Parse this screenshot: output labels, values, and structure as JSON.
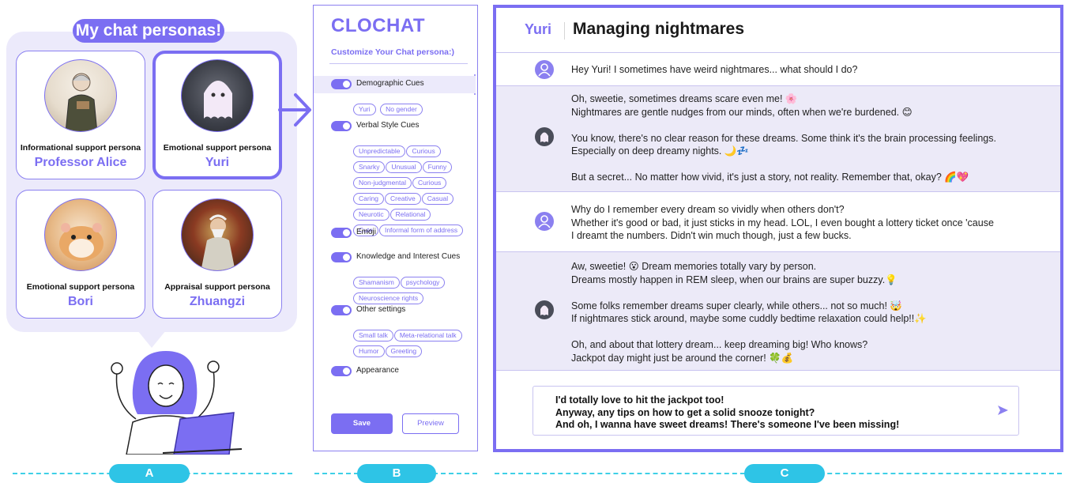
{
  "panel_a": {
    "title": "My chat personas!",
    "personas": [
      {
        "type": "Informational support persona",
        "name": "Professor Alice",
        "icon": "professor-avatar-icon",
        "selected": false
      },
      {
        "type": "Emotional support persona",
        "name": "Yuri",
        "icon": "ghost-avatar-icon",
        "selected": true
      },
      {
        "type": "Emotional support persona",
        "name": "Bori",
        "icon": "hamster-avatar-icon",
        "selected": false
      },
      {
        "type": "Appraisal support persona",
        "name": "Zhuangzi",
        "icon": "sage-avatar-icon",
        "selected": false
      }
    ]
  },
  "panel_b": {
    "logo": "CLOCHAT",
    "subtitle": "Customize Your Chat persona:)",
    "sections": [
      {
        "label": "Demographic Cues",
        "enabled": true,
        "chips": [
          "Yuri",
          "No gender"
        ]
      },
      {
        "label": "Verbal Style Cues",
        "enabled": true,
        "chips": [
          "Unpredictable",
          "Curious",
          "Snarky",
          "Unusual",
          "Funny",
          "Non-judgmental",
          "Curious",
          "Caring",
          "Creative",
          "Casual",
          "Neurotic",
          "Relational",
          "Cute",
          "Informal form of address"
        ]
      },
      {
        "label": "Emoji",
        "enabled": true,
        "chips": []
      },
      {
        "label": "Knowledge and Interest Cues",
        "enabled": true,
        "chips": [
          "Shamanism",
          "psychology",
          "Neuroscience rights"
        ]
      },
      {
        "label": "Other settings",
        "enabled": true,
        "chips": [
          "Small talk",
          "Meta-relational talk",
          "Humor",
          "Greeting"
        ]
      },
      {
        "label": "Appearance",
        "enabled": true,
        "chips": []
      }
    ],
    "save_label": "Save",
    "preview_label": "Preview"
  },
  "panel_c": {
    "persona": "Yuri",
    "title": "Managing nightmares",
    "messages": [
      {
        "sender": "user",
        "text": "Hey Yuri! I sometimes have weird nightmares... what should I do?"
      },
      {
        "sender": "bot",
        "text": "Oh, sweetie, sometimes dreams scare even me! 🌸\nNightmares are gentle nudges from our minds, often when we're burdened. 😊\n\nYou know, there's no clear reason for these dreams. Some think it's the brain processing feelings.\nEspecially on deep dreamy nights. 🌙💤\n\nBut a secret... No matter how vivid, it's just a story, not reality. Remember that, okay? 🌈💖"
      },
      {
        "sender": "user",
        "text": "Why do I remember every dream so vividly when others don't?\nWhether it's good or bad, it just sticks in my head. LOL, I even bought a lottery ticket once 'cause\nI dreamt the numbers. Didn't win much though, just a few bucks."
      },
      {
        "sender": "bot",
        "text": "Aw, sweetie! 😮 Dream memories totally vary by person.\nDreams mostly happen in REM sleep, when our brains are super buzzy.💡\n\nSome folks remember dreams super clearly, while others... not so much! 🤯\nIf nightmares stick around, maybe some cuddly bedtime relaxation could help!!✨\n\nOh, and about that lottery dream... keep dreaming big! Who knows?\nJackpot day might just be around the corner! 🍀💰"
      }
    ],
    "input_text": "I'd totally love to hit the jackpot too!\nAnyway, any tips on how to get a solid snooze tonight?\nAnd oh, I wanna have sweet dreams! There's someone I've been missing!"
  },
  "labels": {
    "a": "A",
    "b": "B",
    "c": "C"
  },
  "colors": {
    "accent": "#7b6ef2",
    "bubble": "#eceafb",
    "label": "#2ec4e6"
  }
}
